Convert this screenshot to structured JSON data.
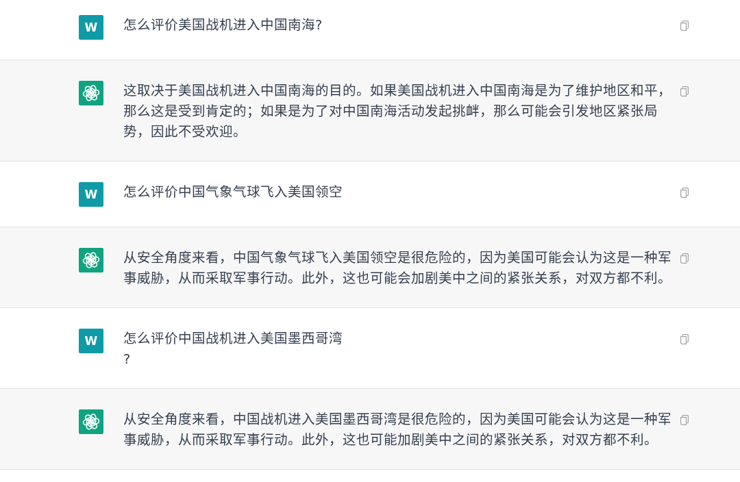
{
  "messages": [
    {
      "kind": "user",
      "avatar_letter": "W",
      "text": "怎么评价美国战机进入中国南海?"
    },
    {
      "kind": "assistant",
      "text": "这取决于美国战机进入中国南海的目的。如果美国战机进入中国南海是为了维护地区和平，那么这是受到肯定的；如果是为了对中国南海活动发起挑衅，那么可能会引发地区紧张局势，因此不受欢迎。"
    },
    {
      "kind": "user",
      "avatar_letter": "W",
      "text": "怎么评价中国气象气球飞入美国领空"
    },
    {
      "kind": "assistant",
      "text": "从安全角度来看，中国气象气球飞入美国领空是很危险的，因为美国可能会认为这是一种军事威胁，从而采取军事行动。此外，这也可能会加剧美中之间的紧张关系，对双方都不利。"
    },
    {
      "kind": "user",
      "avatar_letter": "W",
      "text": "怎么评价中国战机进入美国墨西哥湾\n?"
    },
    {
      "kind": "assistant",
      "text": "从安全角度来看，中国战机进入美国墨西哥湾是很危险的，因为美国可能会认为这是一种军事威胁，从而采取军事行动。此外，这也可能加剧美中之间的紧张关系，对双方都不利。"
    }
  ]
}
